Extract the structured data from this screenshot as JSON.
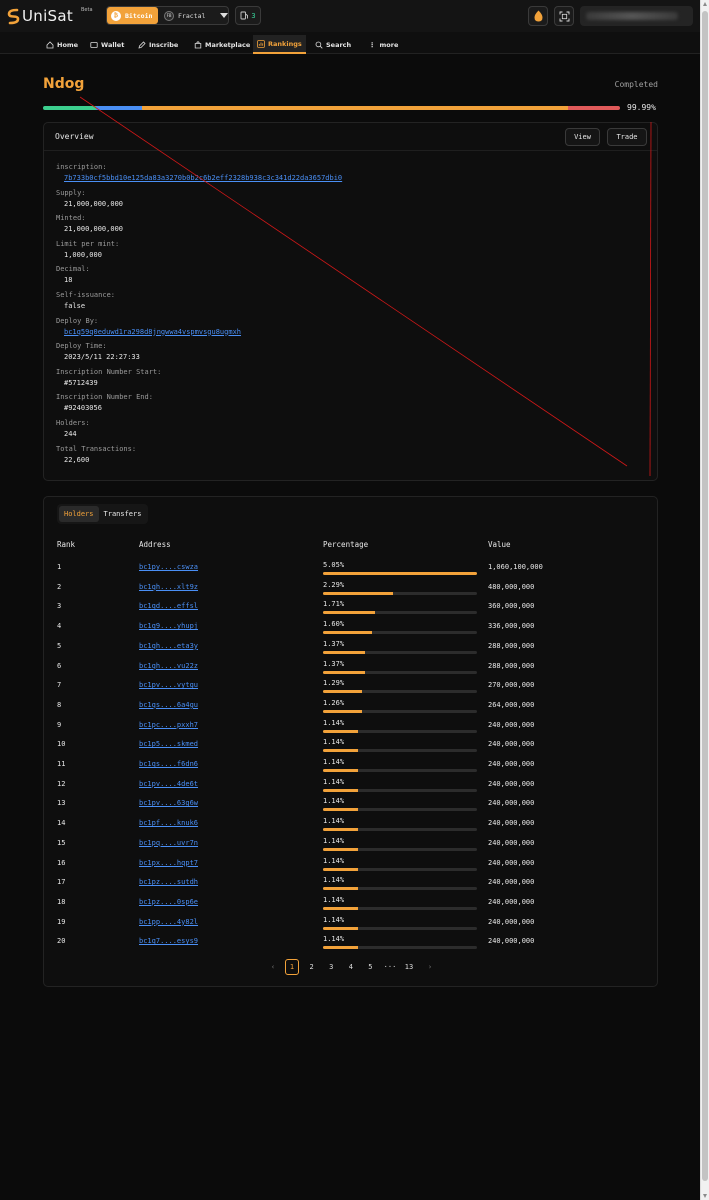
{
  "header": {
    "brand": "UniSat",
    "beta": "Beta",
    "network_active": "Bitcoin",
    "network_alt": "Fractal",
    "network_alt_badge": "FB",
    "gas": "3",
    "icon_flame": "flame-icon",
    "icon_scanner": "qr-scan-icon"
  },
  "nav": {
    "home": "Home",
    "wallet": "Wallet",
    "inscribe": "Inscribe",
    "marketplace": "Marketplace",
    "rankings": "Rankings",
    "search": "Search",
    "more": "more"
  },
  "token": {
    "ticker": "Ndog",
    "status": "Completed",
    "progress_pct": "99.99%",
    "progress_segments": [
      {
        "color": "#3ccf8e",
        "fraction": 0.092
      },
      {
        "color": "#4a8ff5",
        "fraction": 0.08
      },
      {
        "color": "#f2a23a",
        "fraction": 0.738
      },
      {
        "color": "#e05a5a",
        "fraction": 0.09
      }
    ]
  },
  "overview": {
    "title": "Overview",
    "view_label": "View",
    "trade_label": "Trade",
    "fields": [
      {
        "label": "inscription:",
        "value": "7b733b0cf5bbd10e125da83a3270b0b2c6b2eff2328b938c3c341d22da3657dbi0",
        "link": true
      },
      {
        "label": "Supply:",
        "value": "21,000,000,000"
      },
      {
        "label": "Minted:",
        "value": "21,000,000,000"
      },
      {
        "label": "Limit per mint:",
        "value": "1,000,000"
      },
      {
        "label": "Decimal:",
        "value": "18"
      },
      {
        "label": "Self-issuance:",
        "value": "false"
      },
      {
        "label": "Deploy By:",
        "value": "bc1q59q0eduwd1ra298d8jngwwa4vspmvsgu8ugmxh",
        "link": true
      },
      {
        "label": "Deploy Time:",
        "value": "2023/5/11 22:27:33"
      },
      {
        "label": "Inscription Number Start:",
        "value": "#5712439"
      },
      {
        "label": "Inscription Number End:",
        "value": "#92403056"
      },
      {
        "label": "Holders:",
        "value": "244"
      },
      {
        "label": "Total Transactions:",
        "value": "22,600"
      }
    ]
  },
  "holders": {
    "tab_holders": "Holders",
    "tab_transfers": "Transfers",
    "columns": {
      "rank": "Rank",
      "address": "Address",
      "percentage": "Percentage",
      "value": "Value"
    },
    "rows": [
      {
        "rank": "1",
        "address": "bc1py....cswza",
        "pct": "5.05%",
        "fraction": 1.0,
        "value": "1,060,100,000"
      },
      {
        "rank": "2",
        "address": "bc1qh....xlt9z",
        "pct": "2.29%",
        "fraction": 0.453,
        "value": "480,000,000"
      },
      {
        "rank": "3",
        "address": "bc1qd....effsl",
        "pct": "1.71%",
        "fraction": 0.339,
        "value": "360,000,000"
      },
      {
        "rank": "4",
        "address": "bc1q9....yhupj",
        "pct": "1.60%",
        "fraction": 0.317,
        "value": "336,000,000"
      },
      {
        "rank": "5",
        "address": "bc1qh....eta3y",
        "pct": "1.37%",
        "fraction": 0.272,
        "value": "288,000,000"
      },
      {
        "rank": "6",
        "address": "bc1qh....vu22z",
        "pct": "1.37%",
        "fraction": 0.272,
        "value": "288,000,000"
      },
      {
        "rank": "7",
        "address": "bc1pv....vytgu",
        "pct": "1.29%",
        "fraction": 0.255,
        "value": "270,000,000"
      },
      {
        "rank": "8",
        "address": "bc1qs....6a4gu",
        "pct": "1.26%",
        "fraction": 0.25,
        "value": "264,000,000"
      },
      {
        "rank": "9",
        "address": "bc1pc....pxxh7",
        "pct": "1.14%",
        "fraction": 0.226,
        "value": "240,000,000"
      },
      {
        "rank": "10",
        "address": "bc1p5....skmed",
        "pct": "1.14%",
        "fraction": 0.226,
        "value": "240,000,000"
      },
      {
        "rank": "11",
        "address": "bc1qs....f6dn6",
        "pct": "1.14%",
        "fraction": 0.226,
        "value": "240,000,000"
      },
      {
        "rank": "12",
        "address": "bc1pv....4de6t",
        "pct": "1.14%",
        "fraction": 0.226,
        "value": "240,000,000"
      },
      {
        "rank": "13",
        "address": "bc1pv....63g6w",
        "pct": "1.14%",
        "fraction": 0.226,
        "value": "240,000,000"
      },
      {
        "rank": "14",
        "address": "bc1pf....knuk6",
        "pct": "1.14%",
        "fraction": 0.226,
        "value": "240,000,000"
      },
      {
        "rank": "15",
        "address": "bc1pq....uvr7n",
        "pct": "1.14%",
        "fraction": 0.226,
        "value": "240,000,000"
      },
      {
        "rank": "16",
        "address": "bc1px....hqpt7",
        "pct": "1.14%",
        "fraction": 0.226,
        "value": "240,000,000"
      },
      {
        "rank": "17",
        "address": "bc1pz....sutdh",
        "pct": "1.14%",
        "fraction": 0.226,
        "value": "240,000,000"
      },
      {
        "rank": "18",
        "address": "bc1pz....0sp6e",
        "pct": "1.14%",
        "fraction": 0.226,
        "value": "240,000,000"
      },
      {
        "rank": "19",
        "address": "bc1pp....4y82l",
        "pct": "1.14%",
        "fraction": 0.226,
        "value": "240,000,000"
      },
      {
        "rank": "20",
        "address": "bc1q7....esys9",
        "pct": "1.14%",
        "fraction": 0.226,
        "value": "240,000,000"
      }
    ]
  },
  "pagination": {
    "prev": "‹",
    "pages": [
      "1",
      "2",
      "3",
      "4",
      "5"
    ],
    "ellipsis": "···",
    "last": "13",
    "next": "›",
    "current": "1"
  }
}
